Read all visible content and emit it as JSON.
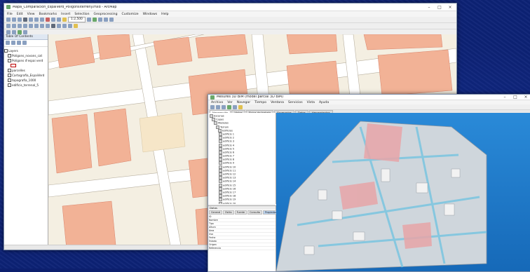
{
  "arcmap": {
    "title": "Mapa_Comparacion_EspaiVerd_Poligonsiterreny.mxd - ArcMap",
    "menu": [
      "File",
      "Edit",
      "View",
      "Bookmarks",
      "Insert",
      "Selection",
      "Geoprocessing",
      "Customize",
      "Windows",
      "Help"
    ],
    "scale": "1:2,500",
    "toc_title": "Table Of Contents",
    "toc_items": [
      {
        "label": "Layers",
        "kind": "group"
      },
      {
        "label": "Poligons_novans_cat",
        "kind": "layer"
      },
      {
        "label": "Poligons d'espai verd",
        "kind": "layer"
      },
      {
        "label": "",
        "kind": "swatch"
      },
      {
        "label": "parcelles",
        "kind": "layer"
      },
      {
        "label": "Cartografia_EspaiVerd",
        "kind": "layer"
      },
      {
        "label": "topografia_1000",
        "kind": "layer"
      },
      {
        "label": "edificis_terrenal_5",
        "kind": "layer"
      }
    ]
  },
  "scene": {
    "title": "Mesures 3D BIM (model parcial 3D BIM)",
    "menu": [
      "Archivo",
      "Ver",
      "Navegar",
      "Tiempo",
      "Ventana",
      "Servicios",
      "Vista",
      "Ayuda"
    ],
    "tabs": [
      "Navegación",
      "Vistas",
      "Flujos de trabajo",
      "Escenarios",
      "Datos",
      "Herramientas"
    ],
    "tree_root": "Escenas",
    "tree_items": [
      "Capas",
      "Modelos",
      "Terrain",
      "Edificios",
      "edificis 1",
      "edificis 2",
      "edificis 3",
      "edificis 4",
      "edificis 5",
      "edificis 6",
      "edificis 7",
      "edificis 8",
      "edificis 9",
      "edificis 10",
      "edificis 11",
      "edificis 12",
      "edificis 13",
      "edificis 14",
      "edificis 15",
      "edificis 16",
      "edificis 17",
      "edificis 18",
      "edificis 19",
      "edificis 20"
    ],
    "props_title": "Datos",
    "props_tabs": [
      "General",
      "Estilo",
      "Fuente",
      "Consulta",
      "Propiedades"
    ],
    "props_rows": [
      "ID",
      "Nombre",
      "Tipo",
      "Altura",
      "Área",
      "Uso",
      "Fecha",
      "Estado",
      "Origen",
      "Referencia"
    ]
  },
  "colors": {
    "desktop": "#0d2276",
    "map_bg": "#f4efe2",
    "building": "#f0a988",
    "river": "#e8d9b8",
    "scene_sky": "#1d78c6"
  }
}
